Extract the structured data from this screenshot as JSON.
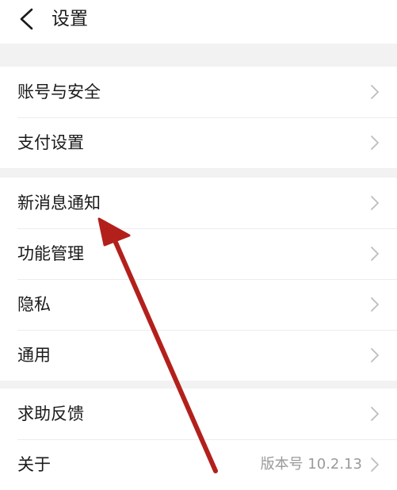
{
  "header": {
    "title": "设置",
    "back_icon": "chevron-left-icon"
  },
  "groups": [
    {
      "items": [
        {
          "label": "账号与安全"
        },
        {
          "label": "支付设置"
        }
      ]
    },
    {
      "items": [
        {
          "label": "新消息通知"
        },
        {
          "label": "功能管理"
        },
        {
          "label": "隐私"
        },
        {
          "label": "通用"
        }
      ]
    },
    {
      "items": [
        {
          "label": "求助反馈"
        },
        {
          "label": "关于",
          "value": "版本号 10.2.13"
        }
      ]
    }
  ],
  "annotation": {
    "type": "arrow",
    "color": "#b3201c",
    "points_to": "新消息通知"
  },
  "colors": {
    "background": "#f2f2f2",
    "surface": "#ffffff",
    "text": "#1a1a1a",
    "secondary_text": "#9a9a9a",
    "chevron": "#bdbdbd"
  }
}
